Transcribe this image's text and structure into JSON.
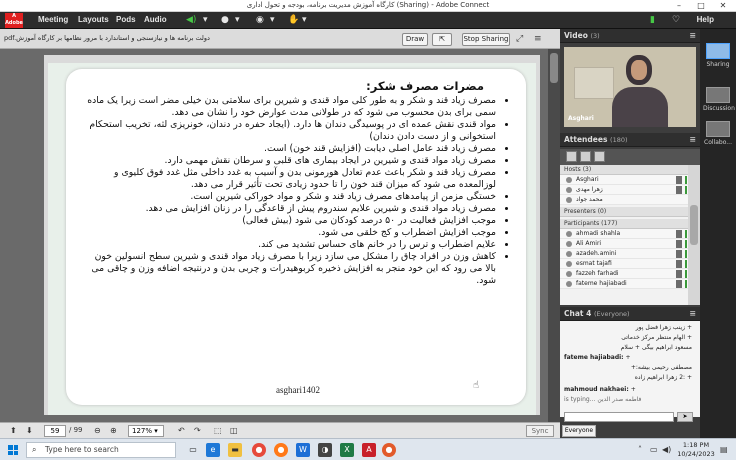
{
  "window": {
    "title": "کارگاه آموزش مدیریت برنامه، بودجه و تحول اداری (Sharing) - Adobe Connect",
    "controls": [
      "–",
      "□",
      "✕"
    ]
  },
  "menubar": {
    "logo_text": "Adobe",
    "items": [
      "Meeting",
      "Layouts",
      "Pods",
      "Audio"
    ],
    "help": "Help"
  },
  "share": {
    "doc_name": "pdf.دولت برنامه ها و نیازسنجی و استاندارد با مرور نظامها بر کارگاه آموزش",
    "draw_label": "Draw",
    "stop_label": "Stop Sharing",
    "page_current": "59",
    "page_total": "/ 99",
    "zoom": "127%",
    "sync_label": "Sync"
  },
  "slide": {
    "title": "مضرات مصرف شکر:",
    "bullets": [
      "مصرف زیاد قند و شکر و به طور کلی مواد قندی و شیرین برای سلامتی بدن خیلی مضر است زیرا یک ماده سمی برای بدن محسوب می شود که در طولانی مدت عوارض خود را نشان می دهد.",
      "مواد قندی نقش عمده ای در پوسیدگی دندان ها دارد. (ایجاد حفره در دندان، خونریزی لثه، تخریب استحکام استخوانی و از دست دادن دندان)",
      "مصرف زیاد قند عامل اصلی دیابت (افزایش قند خون) است.",
      "مصرف زیاد مواد قندی و شیرین در ایجاد بیماری های قلبی و سرطان نقش مهمی دارد.",
      "مصرف زیاد قند و شکر باعث عدم تعادل هورمونی بدن و آسیب به غدد داخلی مثل غدد فوق کلیوی و لوزالمعده می شود که میزان قند خون را تا حدود زیادی تحت تأثیر قرار می دهد.",
      "خستگی مزمن از پیامدهای مصرف زیاد قند و شکر و مواد خوراکی شیرین است.",
      "مصرف زیاد مواد قندی و شیرین علایم سندروم پیش از قاعدگی را در زنان افزایش می دهد.",
      "موجب افزایش فعالیت در ۵۰ درصد کودکان می شود (بیش فعالی)",
      "موجب افزایش اضطراب و کج خلقی می شود.",
      "علایم اضطراب و ترس را در خانم های حساس تشدید می کند.",
      "کاهش وزن در افراد چاق را مشکل می سازد زیرا با مصرف زیاد مواد قندی و شیرین سطح انسولین خون بالا می رود که این خود منجر به افزایش ذخیره کربوهیدرات و چربی بدن و درنتیجه اضافه وزن و چاقی می شود."
    ],
    "footer": "asghari1402"
  },
  "video": {
    "title": "Video",
    "count": "(3)",
    "presenter": "Asghari"
  },
  "attendees": {
    "title": "Attendees",
    "count": "(180)",
    "hosts_label": "Hosts (3)",
    "hosts": [
      "Asghari",
      "زهرا مهدی",
      "محمد جواد"
    ],
    "presenters_label": "Presenters (0)",
    "participants_label": "Participants (177)",
    "participants": [
      "ahmadi shahla",
      "Ali Amiri",
      "azadeh.amini",
      "esmat tajafi",
      "fazzeh farhadi",
      "fateme hajiabadi"
    ]
  },
  "chat": {
    "title": "Chat 4",
    "scope": "(Everyone)",
    "lines": [
      {
        "name": "",
        "text": "+ زینب زهرا فضل پور",
        "rtl": true
      },
      {
        "name": "",
        "text": "+ الهام منتظر مرکز خدماتی",
        "rtl": true
      },
      {
        "name": "",
        "text": "مسعود ابراهیم بیگی + سلام",
        "rtl": true
      },
      {
        "name": "fateme hajiabadi:",
        "text": "+",
        "rtl": false
      },
      {
        "name": "",
        "text": "مصطفی رحیمی بیشه:+",
        "rtl": true
      },
      {
        "name": "",
        "text": "+ :2 زهرا ابراهیم زاده",
        "rtl": true
      },
      {
        "name": "mahmoud nakhaei:",
        "text": "+",
        "rtl": false
      },
      {
        "name": "",
        "text": "is typing... فاطمه صدر الدین",
        "rtl": false
      }
    ],
    "tab": "Everyone"
  },
  "layouts": [
    "Sharing",
    "Discussion",
    "Collabo..."
  ],
  "taskbar": {
    "search_placeholder": "Type here to search",
    "time": "1:18 PM",
    "date": "10/24/2023"
  }
}
